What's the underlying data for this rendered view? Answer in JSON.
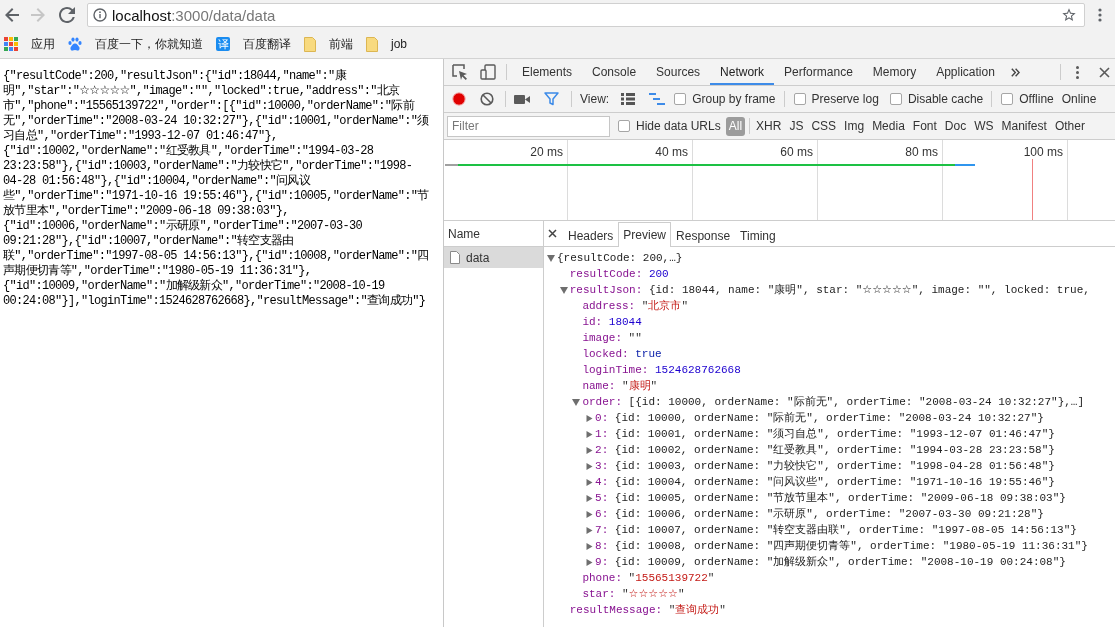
{
  "browser": {
    "nav_buttons": [
      {
        "kind": "back",
        "disabled": false
      },
      {
        "kind": "forward",
        "disabled": true
      },
      {
        "kind": "reload",
        "disabled": false
      }
    ],
    "address": {
      "host": "localhost",
      "path": ":3000/data/data"
    },
    "bookmarked": false
  },
  "bookmarks": [
    {
      "kind": "apps",
      "label": "应用"
    },
    {
      "kind": "paw",
      "label": "百度一下，你就知道"
    },
    {
      "kind": "badge",
      "badge": "译",
      "label": "百度翻译"
    },
    {
      "kind": "folder",
      "label": "前端"
    },
    {
      "kind": "folder",
      "label": "job"
    }
  ],
  "page": {
    "raw_json_lines": [
      "{\"resultCode\":200,\"resultJson\":{\"id\":18044,\"name\":\"康",
      "明\",\"star\":\"☆☆☆☆☆\",\"image\":\"\",\"locked\":true,\"address\":\"北京",
      "市\",\"phone\":\"15565139722\",\"order\":[{\"id\":10000,\"orderName\":\"际前",
      "无\",\"orderTime\":\"2008-03-24 10:32:27\"},{\"id\":10001,\"orderName\":\"须",
      "习自总\",\"orderTime\":\"1993-12-07 01:46:47\"},",
      "{\"id\":10002,\"orderName\":\"红受教具\",\"orderTime\":\"1994-03-28",
      "23:23:58\"},{\"id\":10003,\"orderName\":\"力较快它\",\"orderTime\":\"1998-",
      "04-28 01:56:48\"},{\"id\":10004,\"orderName\":\"问风议",
      "些\",\"orderTime\":\"1971-10-16 19:55:46\"},{\"id\":10005,\"orderName\":\"节",
      "放节里本\",\"orderTime\":\"2009-06-18 09:38:03\"},",
      "{\"id\":10006,\"orderName\":\"示研原\",\"orderTime\":\"2007-03-30",
      "09:21:28\"},{\"id\":10007,\"orderName\":\"转空支器由",
      "联\",\"orderTime\":\"1997-08-05 14:56:13\"},{\"id\":10008,\"orderName\":\"四",
      "声期便切青等\",\"orderTime\":\"1980-05-19 11:36:31\"},",
      "{\"id\":10009,\"orderName\":\"加解级新众\",\"orderTime\":\"2008-10-19",
      "00:24:08\"}],\"loginTime\":1524628762668},\"resultMessage\":\"查询成功\"}"
    ]
  },
  "devtools": {
    "tabs": [
      {
        "label": "Elements",
        "selected": false
      },
      {
        "label": "Console",
        "selected": false
      },
      {
        "label": "Sources",
        "selected": false
      },
      {
        "label": "Network",
        "selected": true
      },
      {
        "label": "Performance",
        "selected": false
      },
      {
        "label": "Memory",
        "selected": false
      },
      {
        "label": "Application",
        "selected": false
      }
    ],
    "network_toolbar": {
      "recording": true,
      "capture_screenshots": false,
      "filter_shown": true,
      "view_label": "View:",
      "view_toggles": [
        {
          "kind": "large-rows",
          "on": false
        },
        {
          "kind": "overview",
          "on": true
        }
      ],
      "option_groups": [
        [
          {
            "label": "Group by frame",
            "checked": false
          }
        ],
        [
          {
            "label": "Preserve log",
            "checked": false
          },
          {
            "label": "Disable cache",
            "checked": false
          }
        ],
        [
          {
            "label": "Offline",
            "checked": false
          }
        ]
      ],
      "throttling": "Online"
    },
    "filter_bar": {
      "placeholder": "Filter",
      "hide_data_urls": {
        "label": "Hide data URLs",
        "checked": false
      },
      "types": [
        {
          "label": "All",
          "selected": true
        },
        {
          "label": "XHR",
          "selected": false
        },
        {
          "label": "JS",
          "selected": false
        },
        {
          "label": "CSS",
          "selected": false
        },
        {
          "label": "Img",
          "selected": false
        },
        {
          "label": "Media",
          "selected": false
        },
        {
          "label": "Font",
          "selected": false
        },
        {
          "label": "Doc",
          "selected": false
        },
        {
          "label": "WS",
          "selected": false
        },
        {
          "label": "Manifest",
          "selected": false
        },
        {
          "label": "Other",
          "selected": false
        }
      ]
    },
    "timeline": {
      "ticks": [
        "20 ms",
        "40 ms",
        "60 ms",
        "80 ms",
        "100 ms"
      ]
    },
    "requests": {
      "column": "Name",
      "rows": [
        {
          "name": "data",
          "selected": true
        }
      ]
    },
    "detail_tabs": [
      {
        "label": "Headers",
        "selected": false
      },
      {
        "label": "Preview",
        "selected": true
      },
      {
        "label": "Response",
        "selected": false
      },
      {
        "label": "Timing",
        "selected": false
      }
    ],
    "preview": {
      "value": "{resultCode: 200,…}",
      "expanded": true,
      "children": [
        {
          "key": "resultCode:",
          "kind": "number",
          "value": "200"
        },
        {
          "key": "resultJson:",
          "value": "{id: 18044, name: \"康明\", star: \"☆☆☆☆☆\", image: \"\", locked: true,",
          "expanded": true,
          "children": [
            {
              "key": "address:",
              "kind": "string",
              "value": "\"北京市\""
            },
            {
              "key": "id:",
              "kind": "number",
              "value": "18044"
            },
            {
              "key": "image:",
              "kind": "string",
              "value": "\"\""
            },
            {
              "key": "locked:",
              "kind": "boolean",
              "value": "true"
            },
            {
              "key": "loginTime:",
              "kind": "number",
              "value": "1524628762668"
            },
            {
              "key": "name:",
              "kind": "string",
              "value": "\"康明\""
            },
            {
              "key": "order:",
              "value": "[{id: 10000, orderName: \"际前无\", orderTime: \"2008-03-24 10:32:27\"},…]",
              "expanded": true,
              "children": [
                {
                  "key": "0:",
                  "value": "{id: 10000, orderName: \"际前无\", orderTime: \"2008-03-24 10:32:27\"}",
                  "expanded": false
                },
                {
                  "key": "1:",
                  "value": "{id: 10001, orderName: \"须习自总\", orderTime: \"1993-12-07 01:46:47\"}",
                  "expanded": false
                },
                {
                  "key": "2:",
                  "value": "{id: 10002, orderName: \"红受教具\", orderTime: \"1994-03-28 23:23:58\"}",
                  "expanded": false
                },
                {
                  "key": "3:",
                  "value": "{id: 10003, orderName: \"力较快它\", orderTime: \"1998-04-28 01:56:48\"}",
                  "expanded": false
                },
                {
                  "key": "4:",
                  "value": "{id: 10004, orderName: \"问风议些\", orderTime: \"1971-10-16 19:55:46\"}",
                  "expanded": false
                },
                {
                  "key": "5:",
                  "value": "{id: 10005, orderName: \"节放节里本\", orderTime: \"2009-06-18 09:38:03\"}",
                  "expanded": false
                },
                {
                  "key": "6:",
                  "value": "{id: 10006, orderName: \"示研原\", orderTime: \"2007-03-30 09:21:28\"}",
                  "expanded": false
                },
                {
                  "key": "7:",
                  "value": "{id: 10007, orderName: \"转空支器由联\", orderTime: \"1997-08-05 14:56:13\"}",
                  "expanded": false
                },
                {
                  "key": "8:",
                  "value": "{id: 10008, orderName: \"四声期便切青等\", orderTime: \"1980-05-19 11:36:31\"}",
                  "expanded": false
                },
                {
                  "key": "9:",
                  "value": "{id: 10009, orderName: \"加解级新众\", orderTime: \"2008-10-19 00:24:08\"}",
                  "expanded": false
                }
              ]
            },
            {
              "key": "phone:",
              "kind": "string",
              "value": "\"15565139722\""
            },
            {
              "key": "star:",
              "kind": "string",
              "value": "\"☆☆☆☆☆\""
            }
          ]
        },
        {
          "key": "resultMessage:",
          "kind": "string",
          "value": "\"查询成功\""
        }
      ]
    }
  }
}
